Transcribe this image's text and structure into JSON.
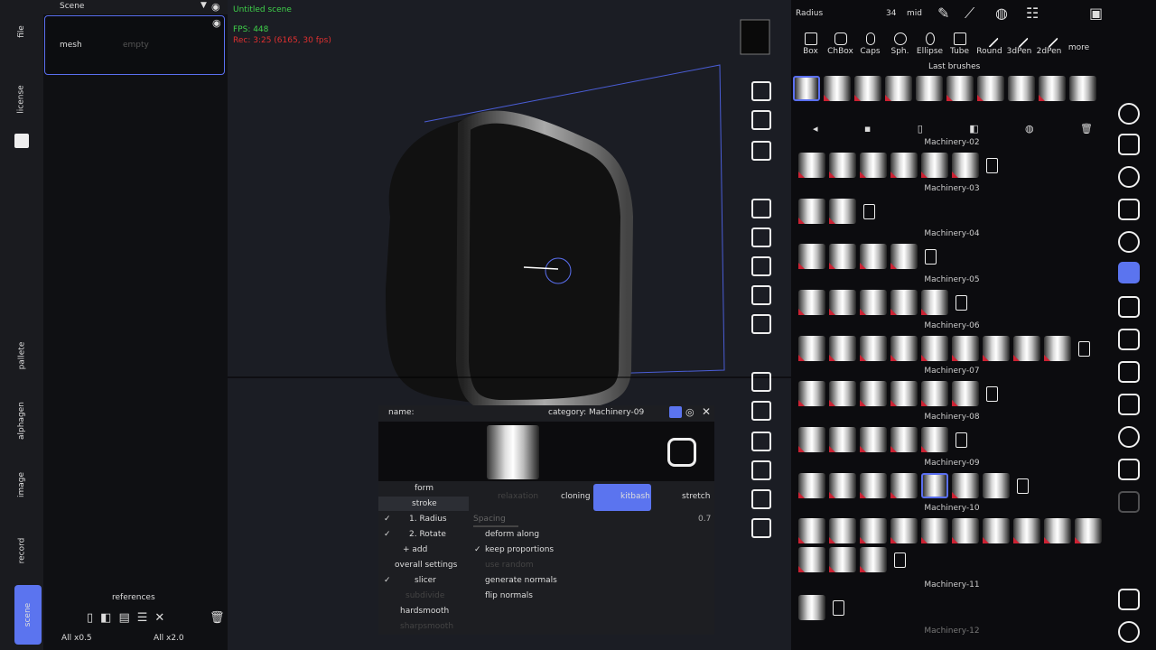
{
  "left_rail": {
    "tabs": [
      "file",
      "license",
      "pallete",
      "alphagen",
      "image",
      "record",
      "scene"
    ]
  },
  "scene_panel": {
    "title": "Scene",
    "mesh_name": "mesh",
    "mesh_status": "empty",
    "references_label": "references",
    "all_half": "All x0.5",
    "all_double": "All x2.0"
  },
  "viewport": {
    "scene_name": "Untitled scene",
    "fps": "FPS: 448",
    "rec": "Rec: 3:25 (6165, 30 fps)"
  },
  "top": {
    "param": "Radius",
    "value": "34",
    "mid": "mid"
  },
  "tools": [
    "Box",
    "ChBox",
    "Caps",
    "Sph.",
    "Ellipse",
    "Tube",
    "Round",
    "3dPen",
    "2dPen",
    "more"
  ],
  "last_brushes": "Last brushes",
  "categories": [
    "Machinery-02",
    "Machinery-03",
    "Machinery-04",
    "Machinery-05",
    "Machinery-06",
    "Machinery-07",
    "Machinery-08",
    "Machinery-09",
    "Machinery-10",
    "Machinery-11",
    "Machinery-12"
  ],
  "dialog": {
    "name": "name:",
    "category": "category: Machinery-09",
    "menu": [
      "form",
      "stroke",
      "1. Radius",
      "2. Rotate",
      "+ add",
      "overall settings",
      "slicer",
      "subdivide",
      "hardsmooth",
      "sharpsmooth"
    ],
    "modes": [
      "relaxation",
      "cloning",
      "kitbash",
      "stretch"
    ],
    "spacing": "Spacing",
    "spacing_val": "0.7",
    "options": [
      "deform along",
      "keep proportions",
      "use random",
      "generate normals",
      "flip normals"
    ]
  },
  "colors": {
    "accent": "#5b74ef",
    "fps": "#3fd14a",
    "rec": "#e03030"
  }
}
